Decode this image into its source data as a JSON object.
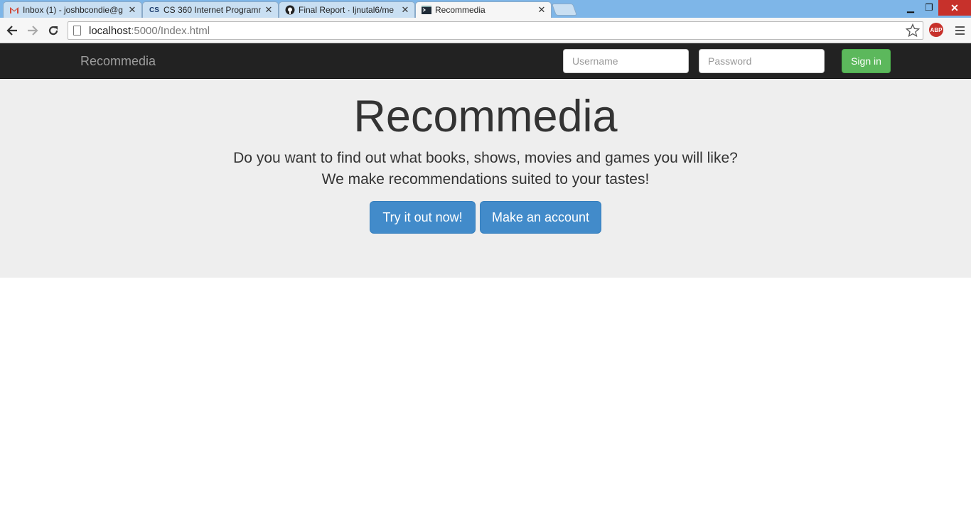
{
  "browser": {
    "tabs": [
      {
        "title": "Inbox (1) - joshbcondie@g",
        "icon": "gmail-icon"
      },
      {
        "title": "CS 360 Internet Programmi",
        "icon": "cs-icon"
      },
      {
        "title": "Final Report · ljnutal6/me",
        "icon": "github-icon"
      },
      {
        "title": "Recommedia",
        "icon": "terminal-icon"
      }
    ],
    "url_host": "localhost",
    "url_rest": ":5000/Index.html",
    "abp_label": "ABP"
  },
  "navbar": {
    "brand": "Recommedia",
    "username_placeholder": "Username",
    "password_placeholder": "Password",
    "signin_label": "Sign in"
  },
  "jumbotron": {
    "title": "Recommedia",
    "line1": "Do you want to find out what books, shows, movies and games you will like?",
    "line2": "We make recommendations suited to your tastes!",
    "try_label": "Try it out now!",
    "account_label": "Make an account"
  },
  "colors": {
    "navbar_bg": "#222222",
    "jumbotron_bg": "#eeeeee",
    "primary": "#428bca",
    "success": "#5cb85c"
  }
}
